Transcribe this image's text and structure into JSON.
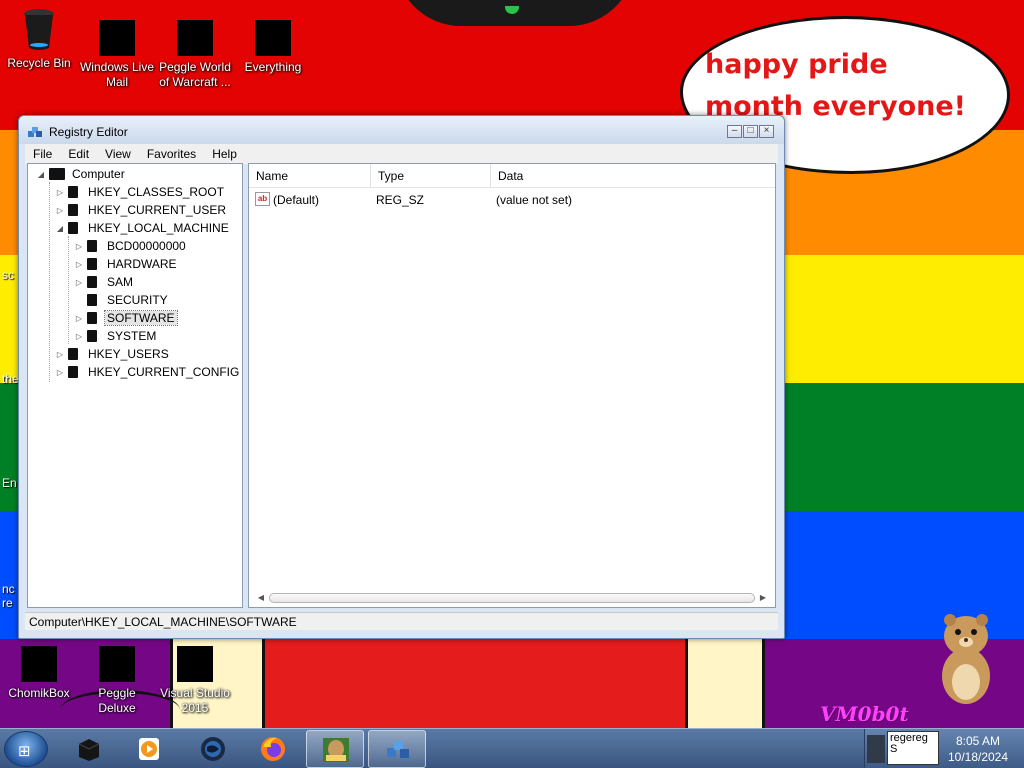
{
  "desktop": {
    "icons_top": [
      {
        "label": "Recycle Bin"
      },
      {
        "label": "Windows Live Mail"
      },
      {
        "label": "Peggle World of Warcraft ..."
      },
      {
        "label": "Everything"
      }
    ],
    "icons_bottom": [
      {
        "label": "ChomikBox"
      },
      {
        "label": "Peggle Deluxe"
      },
      {
        "label": "Visual Studio 2015"
      }
    ],
    "speech_bubble": "happy pride month everyone!",
    "watermark": "VM0b0t",
    "edge_labels": [
      "sc",
      "the",
      "En",
      "nc",
      "re"
    ]
  },
  "window": {
    "title": "Registry Editor",
    "controls": {
      "minimize": "–",
      "maximize": "□",
      "close": "×"
    },
    "menu": [
      "File",
      "Edit",
      "View",
      "Favorites",
      "Help"
    ],
    "tree": [
      {
        "label": "Computer",
        "level": 0,
        "expander": "open",
        "icon": "computer-icon"
      },
      {
        "label": "HKEY_CLASSES_ROOT",
        "level": 1,
        "expander": "closed"
      },
      {
        "label": "HKEY_CURRENT_USER",
        "level": 1,
        "expander": "closed"
      },
      {
        "label": "HKEY_LOCAL_MACHINE",
        "level": 1,
        "expander": "open"
      },
      {
        "label": "BCD00000000",
        "level": 2,
        "expander": "closed"
      },
      {
        "label": "HARDWARE",
        "level": 2,
        "expander": "closed"
      },
      {
        "label": "SAM",
        "level": 2,
        "expander": "closed"
      },
      {
        "label": "SECURITY",
        "level": 2,
        "expander": "none"
      },
      {
        "label": "SOFTWARE",
        "level": 2,
        "expander": "closed",
        "selected": true
      },
      {
        "label": "SYSTEM",
        "level": 2,
        "expander": "closed"
      },
      {
        "label": "HKEY_USERS",
        "level": 1,
        "expander": "closed"
      },
      {
        "label": "HKEY_CURRENT_CONFIG",
        "level": 1,
        "expander": "closed"
      }
    ],
    "columns": [
      "Name",
      "Type",
      "Data"
    ],
    "values": [
      {
        "icon": "ab",
        "name": "(Default)",
        "type": "REG_SZ",
        "data": "(value not set)"
      }
    ],
    "status": "Computer\\HKEY_LOCAL_MACHINE\\SOFTWARE"
  },
  "taskbar": {
    "start_label": "⊞",
    "pinned": [
      {
        "name": "black-box-app-icon"
      },
      {
        "name": "media-player-icon"
      },
      {
        "name": "globe-icon"
      },
      {
        "name": "firefox-icon"
      },
      {
        "name": "chomikbox-icon",
        "active": true
      },
      {
        "name": "registry-editor-icon",
        "active": true
      }
    ],
    "tray_text": "regereg S",
    "time": "8:05 AM",
    "date": "10/18/2024"
  },
  "colors": {
    "red": "#e40303",
    "orange": "#ff8c00",
    "yellow": "#ffed00",
    "green": "#008026",
    "blue": "#004dff",
    "purple": "#750787",
    "bubble_text": "#e41616"
  }
}
